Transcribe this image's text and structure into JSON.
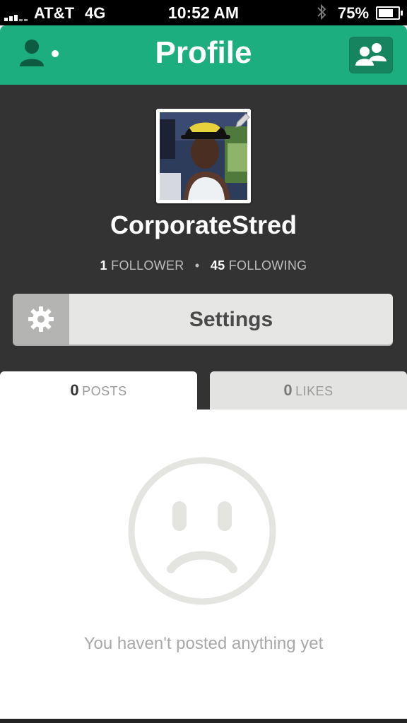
{
  "status_bar": {
    "carrier": "AT&T",
    "network": "4G",
    "time": "10:52 AM",
    "battery_percent": "75%",
    "battery_level": 0.75
  },
  "nav": {
    "title": "Profile",
    "left_icon": "user-profile-icon",
    "right_icon": "people-icon",
    "accent_color": "#1dae80"
  },
  "profile": {
    "username": "CorporateStred",
    "followers_count": "1",
    "followers_label": "FOLLOWER",
    "following_count": "45",
    "following_label": "FOLLOWING",
    "separator": "•"
  },
  "settings": {
    "label": "Settings",
    "icon": "gear-icon"
  },
  "tabs": [
    {
      "count": "0",
      "label": "POSTS",
      "active": true
    },
    {
      "count": "0",
      "label": "LIKES",
      "active": false
    }
  ],
  "empty_state": {
    "icon": "sad-face-icon",
    "message": "You haven't posted anything yet"
  }
}
